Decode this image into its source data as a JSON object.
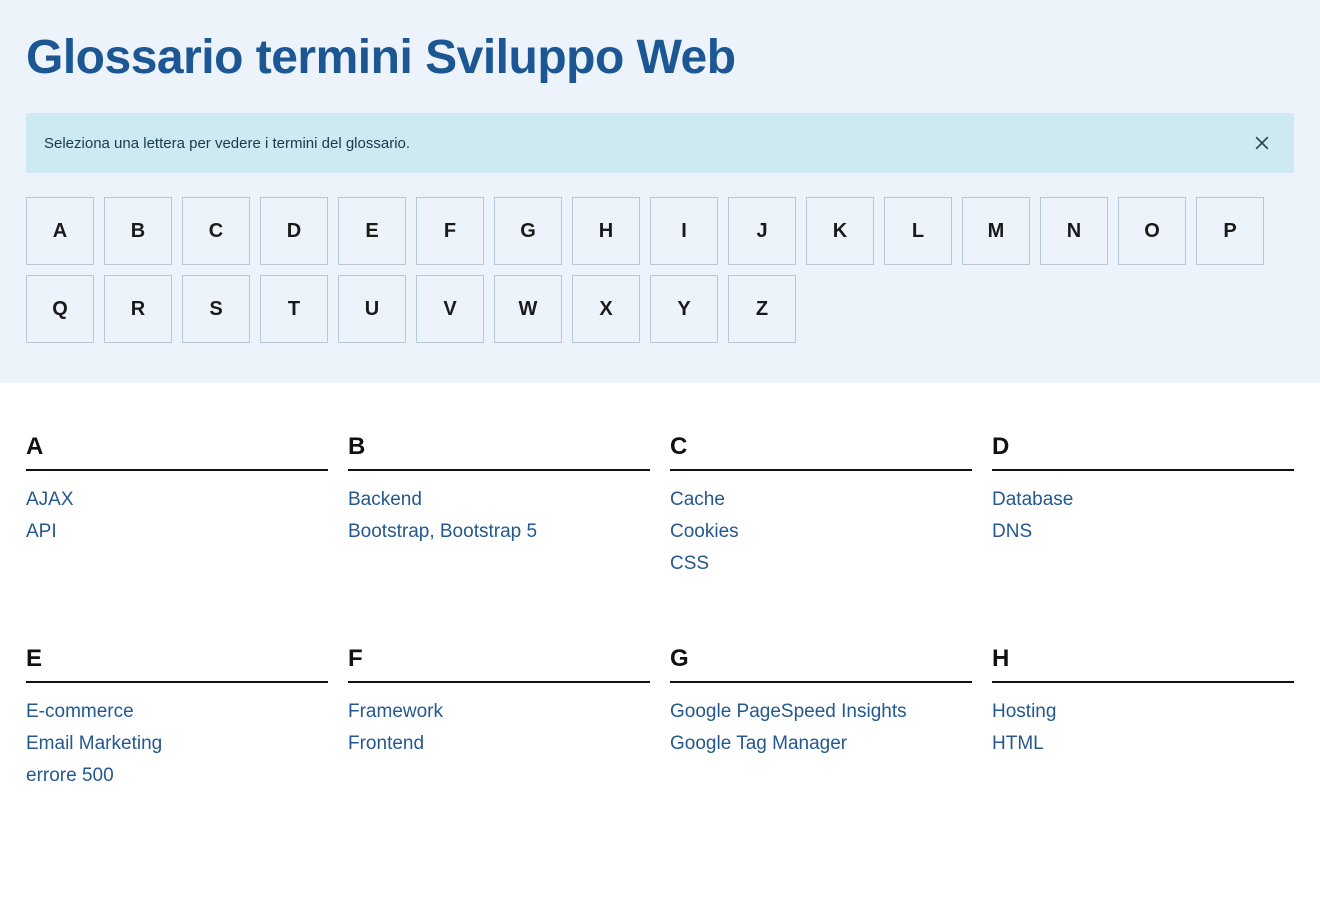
{
  "title": "Glossario termini Sviluppo Web",
  "alert": {
    "text": "Seleziona una lettera per vedere i termini del glossario."
  },
  "letters": [
    "A",
    "B",
    "C",
    "D",
    "E",
    "F",
    "G",
    "H",
    "I",
    "J",
    "K",
    "L",
    "M",
    "N",
    "O",
    "P",
    "Q",
    "R",
    "S",
    "T",
    "U",
    "V",
    "W",
    "X",
    "Y",
    "Z"
  ],
  "glossary": [
    {
      "letter": "A",
      "terms": [
        "AJAX",
        "API"
      ]
    },
    {
      "letter": "B",
      "terms": [
        "Backend",
        "Bootstrap, Bootstrap 5"
      ]
    },
    {
      "letter": "C",
      "terms": [
        "Cache",
        "Cookies",
        "CSS"
      ]
    },
    {
      "letter": "D",
      "terms": [
        "Database",
        "DNS"
      ]
    },
    {
      "letter": "E",
      "terms": [
        "E-commerce",
        "Email Marketing",
        "errore 500"
      ]
    },
    {
      "letter": "F",
      "terms": [
        "Framework",
        "Frontend"
      ]
    },
    {
      "letter": "G",
      "terms": [
        "Google PageSpeed Insights",
        "Google Tag Manager"
      ]
    },
    {
      "letter": "H",
      "terms": [
        "Hosting",
        "HTML"
      ]
    }
  ]
}
